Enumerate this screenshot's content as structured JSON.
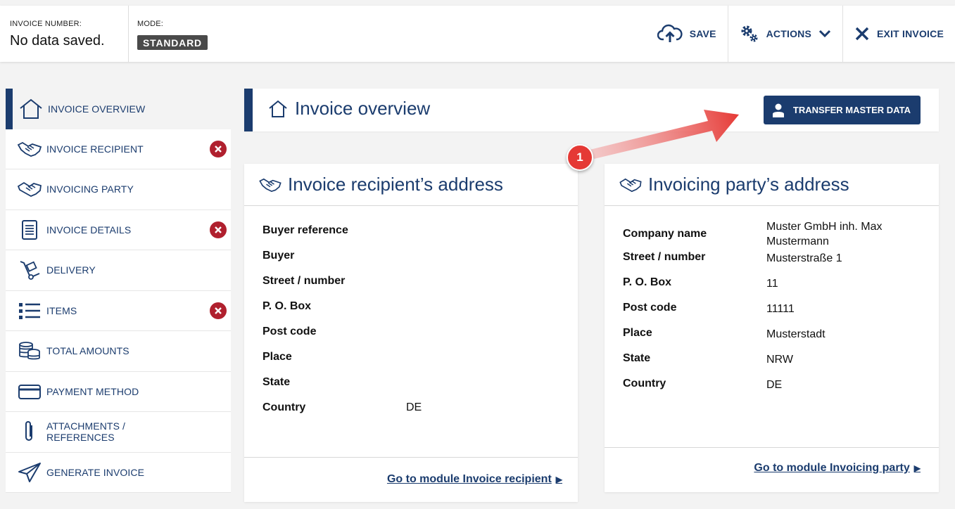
{
  "header": {
    "invoice_number_label": "INVOICE NUMBER:",
    "invoice_number_value": "No data saved.",
    "mode_label": "MODE:",
    "mode_value": "STANDARD",
    "actions": {
      "save": "SAVE",
      "actions": "ACTIONS",
      "exit": "EXIT INVOICE"
    }
  },
  "sidebar": {
    "items": [
      {
        "label": "INVOICE OVERVIEW",
        "icon": "home-icon",
        "active": true,
        "error": false
      },
      {
        "label": "INVOICE RECIPIENT",
        "icon": "handshake-icon",
        "error": true
      },
      {
        "label": "INVOICING PARTY",
        "icon": "handshake-icon",
        "error": false
      },
      {
        "label": "INVOICE DETAILS",
        "icon": "document-icon",
        "error": true
      },
      {
        "label": "DELIVERY",
        "icon": "hand-truck-icon",
        "error": false
      },
      {
        "label": "ITEMS",
        "icon": "list-icon",
        "error": true
      },
      {
        "label": "TOTAL AMOUNTS",
        "icon": "coins-icon",
        "error": false
      },
      {
        "label": "PAYMENT METHOD",
        "icon": "credit-card-icon",
        "error": false
      },
      {
        "label": "ATTACHMENTS / REFERENCES",
        "icon": "paperclip-icon",
        "error": false
      },
      {
        "label": "GENERATE INVOICE",
        "icon": "paper-plane-icon",
        "error": false
      }
    ]
  },
  "main": {
    "title": "Invoice overview",
    "transfer_button": "TRANSFER MASTER DATA",
    "step_badge": "1",
    "recipient_card": {
      "title": "Invoice recipient’s address",
      "rows": [
        {
          "label": "Buyer reference",
          "value": ""
        },
        {
          "label": "Buyer",
          "value": ""
        },
        {
          "label": "Street / number",
          "value": ""
        },
        {
          "label": "P. O. Box",
          "value": ""
        },
        {
          "label": "Post code",
          "value": ""
        },
        {
          "label": "Place",
          "value": ""
        },
        {
          "label": "State",
          "value": ""
        },
        {
          "label": "Country",
          "value": "DE"
        }
      ],
      "link": "Go to module Invoice recipient"
    },
    "party_card": {
      "title": "Invoicing party’s address",
      "rows": [
        {
          "label": "Company name",
          "value": "Muster GmbH inh. Max Mustermann"
        },
        {
          "label": "Street / number",
          "value": "Musterstraße 1"
        },
        {
          "label": "P. O. Box",
          "value": "11"
        },
        {
          "label": "Post code",
          "value": "11111"
        },
        {
          "label": "Place",
          "value": "Musterstadt"
        },
        {
          "label": "State",
          "value": "NRW"
        },
        {
          "label": "Country",
          "value": "DE"
        }
      ],
      "link": "Go to module Invoicing party"
    }
  },
  "colors": {
    "brand": "#1b3c6e",
    "error": "#b0202e",
    "annotation": "#e53935"
  }
}
